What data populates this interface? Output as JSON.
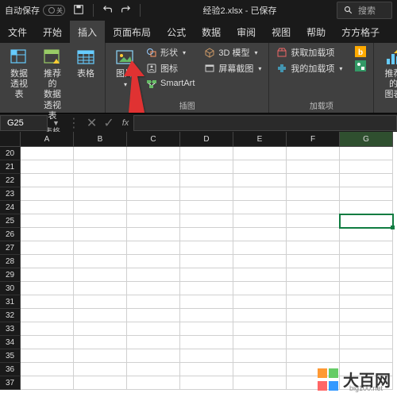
{
  "titlebar": {
    "autosave_label": "自动保存",
    "autosave_state": "关",
    "filename": "经验2.xlsx - 已保存",
    "search_placeholder": "搜索"
  },
  "tabs": {
    "items": [
      {
        "label": "文件"
      },
      {
        "label": "开始"
      },
      {
        "label": "插入"
      },
      {
        "label": "页面布局"
      },
      {
        "label": "公式"
      },
      {
        "label": "数据"
      },
      {
        "label": "审阅"
      },
      {
        "label": "视图"
      },
      {
        "label": "帮助"
      },
      {
        "label": "方方格子"
      }
    ],
    "active_index": 2
  },
  "ribbon": {
    "groups": [
      {
        "label": "表格",
        "big": [
          {
            "label": "数据\n透视表",
            "icon": "pivot"
          },
          {
            "label": "推荐的\n数据透视表",
            "icon": "pivot-rec"
          },
          {
            "label": "表格",
            "icon": "table"
          }
        ]
      },
      {
        "label": "插图",
        "big": [
          {
            "label": "图片",
            "icon": "picture",
            "dropdown": true
          }
        ],
        "small": [
          {
            "label": "形状",
            "icon": "shapes",
            "dropdown": true
          },
          {
            "label": "图标",
            "icon": "icons"
          },
          {
            "label": "SmartArt",
            "icon": "smartart"
          }
        ],
        "small2": [
          {
            "label": "3D 模型",
            "icon": "3d",
            "dropdown": true
          },
          {
            "label": "屏幕截图",
            "icon": "screenshot",
            "dropdown": true
          }
        ]
      },
      {
        "label": "加载项",
        "small": [
          {
            "label": "获取加载项",
            "icon": "store"
          },
          {
            "label": "我的加载项",
            "icon": "myaddins",
            "dropdown": true
          }
        ],
        "side": [
          {
            "icon": "bing"
          },
          {
            "icon": "visio"
          }
        ]
      },
      {
        "label": "",
        "big": [
          {
            "label": "推荐的\n图表",
            "icon": "chart-rec"
          }
        ]
      }
    ]
  },
  "namebox": {
    "ref": "G25",
    "fx": "fx"
  },
  "grid": {
    "columns": [
      "A",
      "B",
      "C",
      "D",
      "E",
      "F",
      "G"
    ],
    "rows": [
      20,
      21,
      22,
      23,
      24,
      25,
      26,
      27,
      28,
      29,
      30,
      31,
      32,
      33,
      34,
      35,
      36,
      37
    ],
    "selected_col": "G",
    "selected_row": 25
  },
  "watermark": {
    "text": "大百网",
    "url": "big100.net",
    "colors": [
      "#ff9933",
      "#66cc66",
      "#ff6666",
      "#3399ff"
    ]
  }
}
